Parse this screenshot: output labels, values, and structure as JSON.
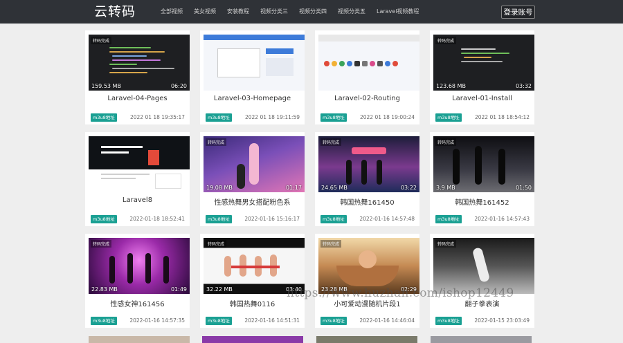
{
  "header": {
    "brand": "云转码",
    "nav": [
      "全部视频",
      "美女视频",
      "安装教程",
      "视频分类三",
      "视频分类四",
      "视频分类五",
      "Laravel视频教程"
    ],
    "login_label": "登录账号"
  },
  "videos": [
    {
      "title": "Laravel-04-Pages",
      "size": "159.53 MB",
      "duration": "06:20",
      "badge": "m3u8地址",
      "time": "2022 01 18 19:35:17",
      "watermark": "转码完成"
    },
    {
      "title": "Laravel-03-Homepage",
      "size": "",
      "duration": "",
      "badge": "m3u8地址",
      "time": "2022 01 18 19:11:59",
      "watermark": ""
    },
    {
      "title": "Laravel-02-Routing",
      "size": "",
      "duration": "",
      "badge": "m3u8地址",
      "time": "2022 01 18 19:00:24",
      "watermark": ""
    },
    {
      "title": "Laravel-01-Install",
      "size": "123.68 MB",
      "duration": "03:32",
      "badge": "m3u8地址",
      "time": "2022 01 18 18:54:12",
      "watermark": "转码完成"
    },
    {
      "title": "Laravel8",
      "size": "",
      "duration": "",
      "badge": "m3u8地址",
      "time": "2022-01-18 18:52:41",
      "watermark": ""
    },
    {
      "title": "性感热舞男女搭配粉色系",
      "size": "19.08 MB",
      "duration": "01:17",
      "badge": "m3u8地址",
      "time": "2022-01-16 15:16:17",
      "watermark": "转码完成"
    },
    {
      "title": "韩国热舞161450",
      "size": "24.65 MB",
      "duration": "03:22",
      "badge": "m3u8地址",
      "time": "2022-01-16 14:57:48",
      "watermark": "转码完成"
    },
    {
      "title": "韩国热舞161452",
      "size": "3.9 MB",
      "duration": "01:50",
      "badge": "m3u8地址",
      "time": "2022-01-16 14:57:43",
      "watermark": "转码完成"
    },
    {
      "title": "性感女神161456",
      "size": "22.83 MB",
      "duration": "01:49",
      "badge": "m3u8地址",
      "time": "2022-01-16 14:57:35",
      "watermark": "转码完成"
    },
    {
      "title": "韩国热舞0116",
      "size": "32.22 MB",
      "duration": "03:40",
      "badge": "m3u8地址",
      "time": "2022-01-16 14:51:31",
      "watermark": "转码完成"
    },
    {
      "title": "小可爱动漫随机片段1",
      "size": "23.28 MB",
      "duration": "02:29",
      "badge": "m3u8地址",
      "time": "2022-01-16 14:46:04",
      "watermark": "转码完成"
    },
    {
      "title": "翻子拳表演",
      "size": "",
      "duration": "",
      "badge": "m3u8地址",
      "time": "2022-01-15 23:03:49",
      "watermark": "转码完成"
    }
  ],
  "overlay_watermark": "https://www.huzhan.com/ishop12449",
  "colors": {
    "navbar": "#2f3237",
    "badge": "#1aa093",
    "page_bg": "#eeeeee"
  }
}
